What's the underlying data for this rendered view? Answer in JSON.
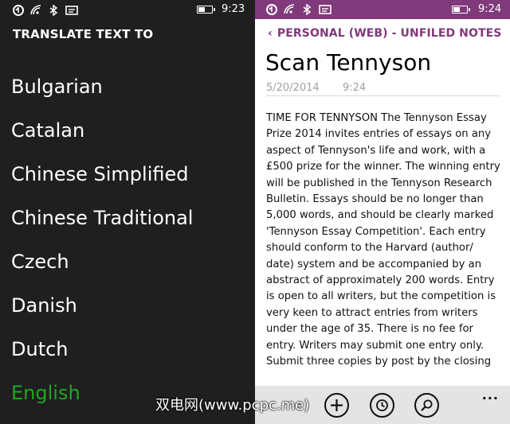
{
  "left_screen": {
    "status_bar": {
      "time": "9:23",
      "icons": [
        "notification-icon",
        "wifi-icon",
        "bluetooth-icon",
        "message-icon"
      ],
      "battery_level": 0.45
    },
    "header": "TRANSLATE TEXT TO",
    "languages": [
      "Bulgarian",
      "Catalan",
      "Chinese Simplified",
      "Chinese Traditional",
      "Czech",
      "Danish",
      "Dutch",
      "English"
    ],
    "selected_language": "English",
    "selected_color": "#1ea81e"
  },
  "right_screen": {
    "status_bar": {
      "time": "9:24",
      "icons": [
        "notification-icon",
        "wifi-icon",
        "bluetooth-icon",
        "message-icon"
      ],
      "battery_level": 0.45,
      "background": "#80397b"
    },
    "breadcrumb": "PERSONAL (WEB) - UNFILED NOTES",
    "accent": "#80397b",
    "note": {
      "title": "Scan Tennyson",
      "date": "5/20/2014",
      "time": "9:24",
      "body": "TIME FOR TENNYSON The Tennyson Essay Prize 2014 invites entries of essays on any aspect of Tennyson's life and work, with a £500 prize for the winner. The winning entry will be published in the Tennyson Research Bulletin. Essays should be no longer than 5,000 words, and should be clearly marked 'Tennyson Essay Competition'. Each entry should conform to the Harvard (author/ date) system and be accompanied by an abstract of approximately 200 words. Entry is open to all writers, but the competition is very keen to attract entries from writers under the age of 35. There is no fee for entry. Writers may submit one entry only. Submit three copies by post by the closing"
    },
    "app_bar": {
      "buttons": [
        "add-icon",
        "recent-icon",
        "search-icon"
      ],
      "more": "..."
    }
  },
  "watermark": "双电网(www.pcpc.me)"
}
